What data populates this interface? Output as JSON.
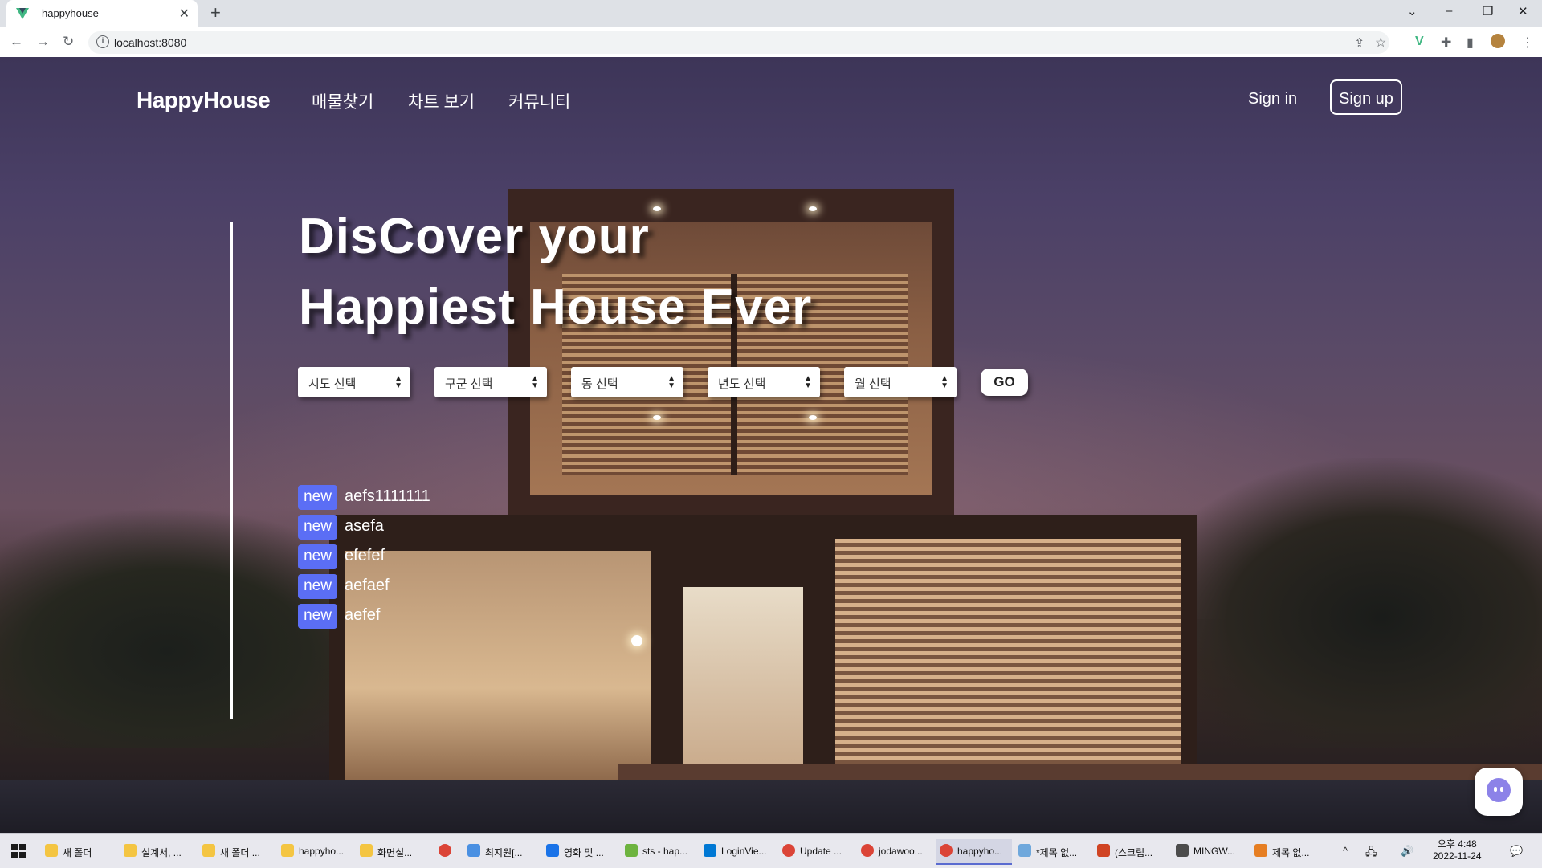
{
  "browser": {
    "tab_title": "happyhouse",
    "tab_close": "✕",
    "new_tab": "+",
    "url": "localhost:8080",
    "info_glyph": "i",
    "nav": {
      "back": "←",
      "forward": "→",
      "reload": "↻"
    },
    "window_controls": {
      "dropdown": "⌄",
      "minimize": "–",
      "restore": "❐",
      "close": "✕"
    },
    "toolbar_icons": [
      "share-icon",
      "star-icon",
      "vue-devtools-icon",
      "puzzle-icon",
      "sidebar-icon",
      "profile-avatar",
      "menu-icon"
    ],
    "toolbar_glyphs": {
      "share": "⇪",
      "star": "☆",
      "vue": "V",
      "puzzle": "✚",
      "sidebar": "▮",
      "menu": "⋮"
    }
  },
  "header": {
    "logo": "HappyHouse",
    "nav": [
      "매물찾기",
      "차트 보기",
      "커뮤니티"
    ],
    "signin": "Sign in",
    "signup": "Sign up"
  },
  "hero": {
    "line1": "DisCover your",
    "line2": "Happiest House Ever"
  },
  "search": {
    "selects": [
      "시도 선택",
      "구군 선택",
      "동 선택",
      "년도 선택",
      "월 선택"
    ],
    "go": "GO"
  },
  "notices": {
    "badge": "new",
    "items": [
      "aefs1111111",
      "asefa",
      "efefef",
      "aefaef",
      "aefef"
    ]
  },
  "colors": {
    "badge": "#5b6ef5",
    "chat": "#8c82e8",
    "vue_green": "#41b883"
  },
  "taskbar": {
    "items": [
      {
        "label": "새 폴더",
        "icon": "folder-icon"
      },
      {
        "label": "설계서, ...",
        "icon": "folder-icon"
      },
      {
        "label": "새 폴더 ...",
        "icon": "folder-icon"
      },
      {
        "label": "happyho...",
        "icon": "folder-icon"
      },
      {
        "label": "화면설...",
        "icon": "folder-icon"
      },
      {
        "label": "",
        "icon": "chrome-icon"
      },
      {
        "label": "최지원[...",
        "icon": "chat-app-icon"
      },
      {
        "label": "영화 및 ...",
        "icon": "movies-icon"
      },
      {
        "label": "sts - hap...",
        "icon": "spring-icon"
      },
      {
        "label": "LoginVie...",
        "icon": "vscode-icon"
      },
      {
        "label": "Update ...",
        "icon": "chrome-icon"
      },
      {
        "label": "jodawoo...",
        "icon": "chrome-icon"
      },
      {
        "label": "happyho...",
        "icon": "chrome-icon"
      },
      {
        "label": "*제목 없...",
        "icon": "notepad-icon"
      },
      {
        "label": "(스크립...",
        "icon": "powerpoint-icon"
      },
      {
        "label": "MINGW...",
        "icon": "git-icon"
      },
      {
        "label": "제목 없...",
        "icon": "paint-icon"
      }
    ],
    "tray_glyphs": {
      "chevron": "^",
      "network": "🖧",
      "volume": "🔊",
      "notification": "💬"
    },
    "clock_time": "오후 4:48",
    "clock_date": "2022-11-24"
  }
}
